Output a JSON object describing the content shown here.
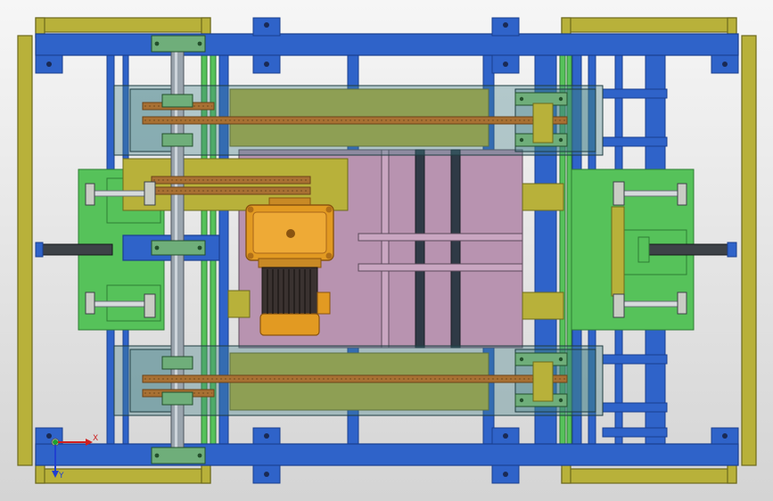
{
  "viewport": {
    "background_top": "#f6f6f6",
    "background_bottom": "#d4d4d4"
  },
  "colors": {
    "frame_blue": "#2f63c9",
    "frame_blue_dark": "#1a3f8f",
    "olive": "#b8b13a",
    "olive_dark": "#6d6a1c",
    "green": "#56c25a",
    "green_dark": "#2f7d34",
    "pink": "#b893b0",
    "gold": "#e29a22",
    "gold_dark": "#8a5410",
    "chain": "#a87033",
    "steel": "#9aa4ad",
    "cylinder": "#3d4247",
    "teal": "#3f7f86"
  },
  "assembly": {
    "frame": "outer-frame",
    "motor": "gear-motor",
    "chains": "chain-drives",
    "cylinders": "pneumatic-cylinders",
    "platform": "lift-platform"
  },
  "triad": {
    "x_label": "X",
    "y_label": "Y",
    "x_color": "#d02020",
    "y_color": "#2040d0",
    "z_color": "#20a030"
  }
}
